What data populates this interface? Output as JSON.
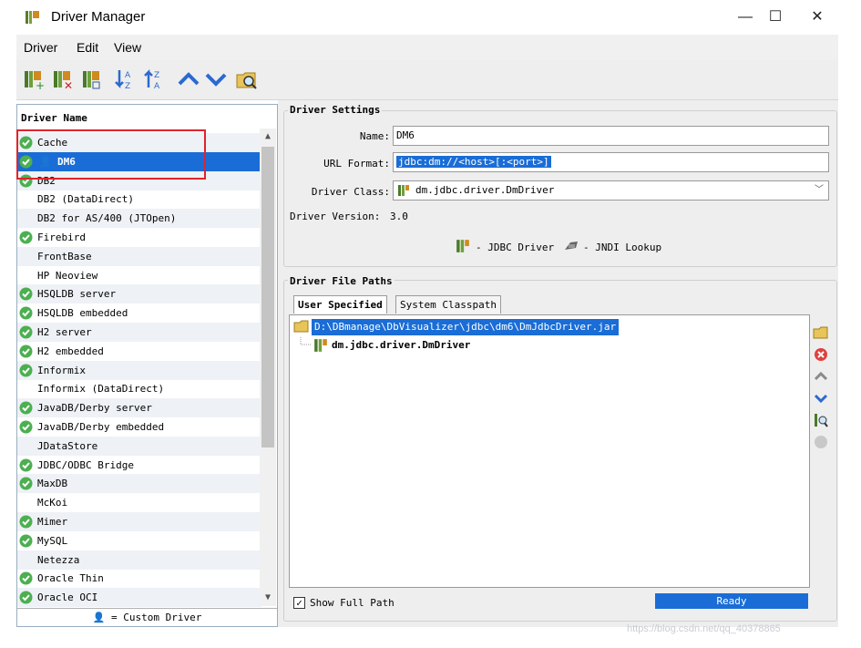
{
  "window": {
    "title": "Driver Manager",
    "minimize": "—",
    "maximize": "☐",
    "close": "✕"
  },
  "menu": [
    "Driver",
    "Edit",
    "View"
  ],
  "toolbar": {
    "icons": [
      "new-driver-icon",
      "delete-driver-icon",
      "copy-driver-icon",
      "sort-ascending-icon",
      "sort-descending-icon",
      "move-up-icon",
      "move-down-icon",
      "find-drivers-icon"
    ]
  },
  "driver_list": {
    "header": "Driver Name",
    "items": [
      {
        "label": "Cache",
        "ok": true
      },
      {
        "label": "DM6",
        "ok": true,
        "custom": true,
        "selected": true
      },
      {
        "label": "DB2",
        "ok": true
      },
      {
        "label": "DB2 (DataDirect)",
        "ok": false
      },
      {
        "label": "DB2 for AS/400 (JTOpen)",
        "ok": false
      },
      {
        "label": "Firebird",
        "ok": true
      },
      {
        "label": "FrontBase",
        "ok": false
      },
      {
        "label": "HP Neoview",
        "ok": false
      },
      {
        "label": "HSQLDB server",
        "ok": true
      },
      {
        "label": "HSQLDB embedded",
        "ok": true
      },
      {
        "label": "H2 server",
        "ok": true
      },
      {
        "label": "H2 embedded",
        "ok": true
      },
      {
        "label": "Informix",
        "ok": true
      },
      {
        "label": "Informix (DataDirect)",
        "ok": false
      },
      {
        "label": "JavaDB/Derby server",
        "ok": true
      },
      {
        "label": "JavaDB/Derby embedded",
        "ok": true
      },
      {
        "label": "JDataStore",
        "ok": false
      },
      {
        "label": "JDBC/ODBC Bridge",
        "ok": true
      },
      {
        "label": "MaxDB",
        "ok": true
      },
      {
        "label": "McKoi",
        "ok": false
      },
      {
        "label": "Mimer",
        "ok": true
      },
      {
        "label": "MySQL",
        "ok": true
      },
      {
        "label": "Netezza",
        "ok": false
      },
      {
        "label": "Oracle Thin",
        "ok": true
      },
      {
        "label": "Oracle OCI",
        "ok": true
      }
    ],
    "footer": "= Custom Driver"
  },
  "settings": {
    "group_title": "Driver Settings",
    "name_label": "Name:",
    "name_value": "DM6",
    "url_label": "URL Format:",
    "url_value": "jdbc:dm://<host>[:<port>]",
    "class_label": "Driver Class:",
    "class_value": "dm.jdbc.driver.DmDriver",
    "version_label": "Driver Version:",
    "version_value": "3.0",
    "legend_jdbc": "- JDBC Driver",
    "legend_jndi": "- JNDI Lookup"
  },
  "paths": {
    "group_title": "Driver File Paths",
    "tab_user": "User Specified",
    "tab_system": "System Classpath",
    "root_path": "D:\\DBmanage\\DbVisualizer\\jdbc\\dm6\\DmJdbcDriver.jar",
    "child": "dm.jdbc.driver.DmDriver",
    "show_full_path_label": "Show Full Path",
    "show_full_path_checked": true,
    "status": "Ready"
  },
  "watermark": "https://blog.csdn.net/qq_40378865",
  "colors": {
    "selection": "#1a6dd6",
    "highlight_box": "#e0242b",
    "ok_green": "#4caf50"
  }
}
